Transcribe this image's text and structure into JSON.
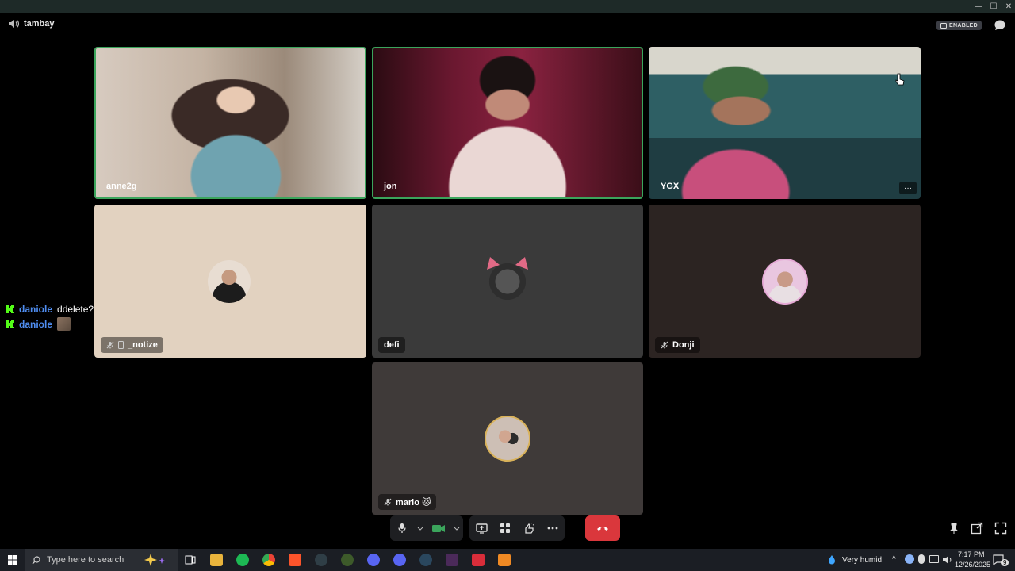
{
  "window": {
    "minimize": "—",
    "maximize": "☐",
    "close": "✕"
  },
  "header": {
    "channel_name": "tambay",
    "status_badge": "ENABLED"
  },
  "participants": [
    {
      "name": "anne2g",
      "speaking": true,
      "video": true
    },
    {
      "name": "jon",
      "speaking": true,
      "video": true
    },
    {
      "name": "YGX",
      "speaking": false,
      "video": true,
      "more": "···"
    },
    {
      "name": "_notize",
      "muted": true,
      "mobile": true
    },
    {
      "name": "defi"
    },
    {
      "name": "Donji",
      "muted": true
    },
    {
      "name": "mario 🐱",
      "muted": true
    }
  ],
  "chat_overlay": [
    {
      "user": "daniole",
      "text": "ddelete?"
    },
    {
      "user": "daniole",
      "text": ""
    }
  ],
  "taskbar": {
    "search_placeholder": "Type here to search",
    "weather": "Very humid",
    "time": "7:17 PM",
    "date": "12/26/2025",
    "notification_count": "9"
  },
  "colors": {
    "speaking_ring": "#3ba55c",
    "end_call": "#da373c",
    "username": "#4f8df0"
  }
}
